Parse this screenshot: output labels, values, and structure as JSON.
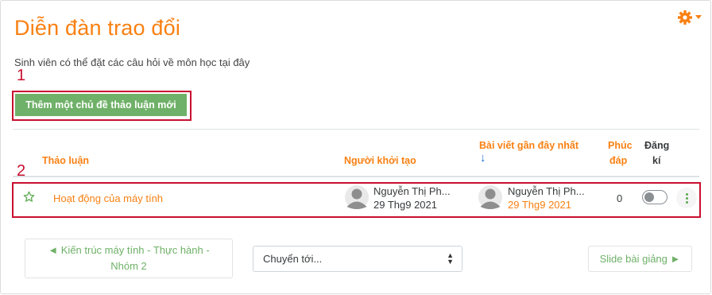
{
  "page": {
    "title": "Diễn đàn trao đổi",
    "description": "Sinh viên có thể đặt các câu hỏi về môn học tại đây"
  },
  "annotations": {
    "marker_1": "1",
    "marker_2": "2"
  },
  "actions": {
    "add_topic_label": "Thêm một chủ đề thảo luận mới"
  },
  "table": {
    "headers": {
      "discussion": "Thảo luận",
      "started_by": "Người khởi tạo",
      "last_post": "Bài viết gần đây nhất",
      "last_post_sort": "↓",
      "replies_line1": "Phúc",
      "replies_line2": "đáp",
      "subscribe_line1": "Đăng",
      "subscribe_line2": "kí"
    },
    "rows": [
      {
        "topic": "Hoạt động của máy tính",
        "starter_name": "Nguyễn Thị Ph...",
        "starter_date": "29 Thg9 2021",
        "last_name": "Nguyễn Thị Ph...",
        "last_date": "29 Thg9 2021",
        "replies": "0",
        "subscribed": false
      }
    ]
  },
  "navigation": {
    "prev_line1": "◄ Kiến trúc máy tính - Thực hành -",
    "prev_line2": "Nhóm 2",
    "jump_to_label": "Chuyển tới...",
    "next_label": "Slide bài giảng ►"
  },
  "colors": {
    "accent": "#f98012",
    "button_green": "#6fb168",
    "annotation_red": "#c8102e"
  },
  "icons": [
    "gear-icon",
    "caret-down-icon",
    "star-icon",
    "avatar-icon",
    "kebab-menu-icon",
    "select-arrows-icon"
  ]
}
